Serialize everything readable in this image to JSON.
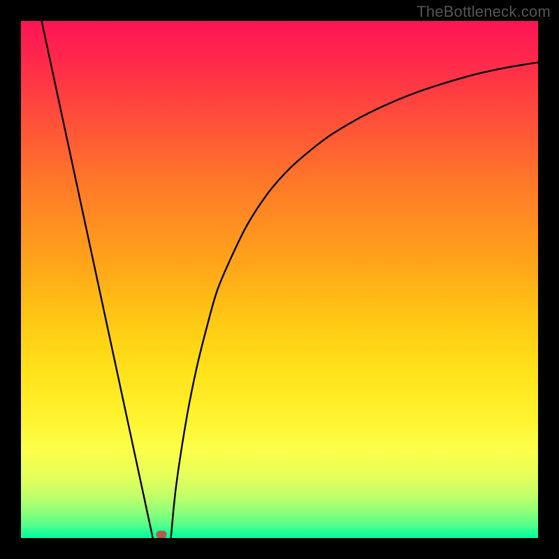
{
  "watermark": "TheBottleneck.com",
  "chart_data": {
    "type": "line",
    "title": "",
    "xlabel": "",
    "ylabel": "",
    "xlim": [
      0,
      100
    ],
    "ylim": [
      0,
      100
    ],
    "annotations": [],
    "series": [
      {
        "name": "left-branch",
        "x": [
          4,
          25.5
        ],
        "y": [
          100,
          0
        ]
      },
      {
        "name": "right-branch",
        "x": [
          29,
          30,
          32,
          34,
          36,
          38,
          41,
          44,
          48,
          52,
          56,
          60,
          65,
          70,
          76,
          82,
          88,
          94,
          100
        ],
        "y": [
          0,
          10,
          23,
          33,
          41,
          48,
          55,
          61,
          67,
          71.5,
          75,
          78,
          81,
          83.5,
          86,
          88,
          89.7,
          91,
          92
        ]
      }
    ],
    "marker": {
      "x": 27.2,
      "y": 0.7,
      "color": "#b35a4a"
    },
    "background_gradient": {
      "top": "#ff1456",
      "middle": "#ffe31a",
      "bottom": "#00ffa2"
    }
  }
}
